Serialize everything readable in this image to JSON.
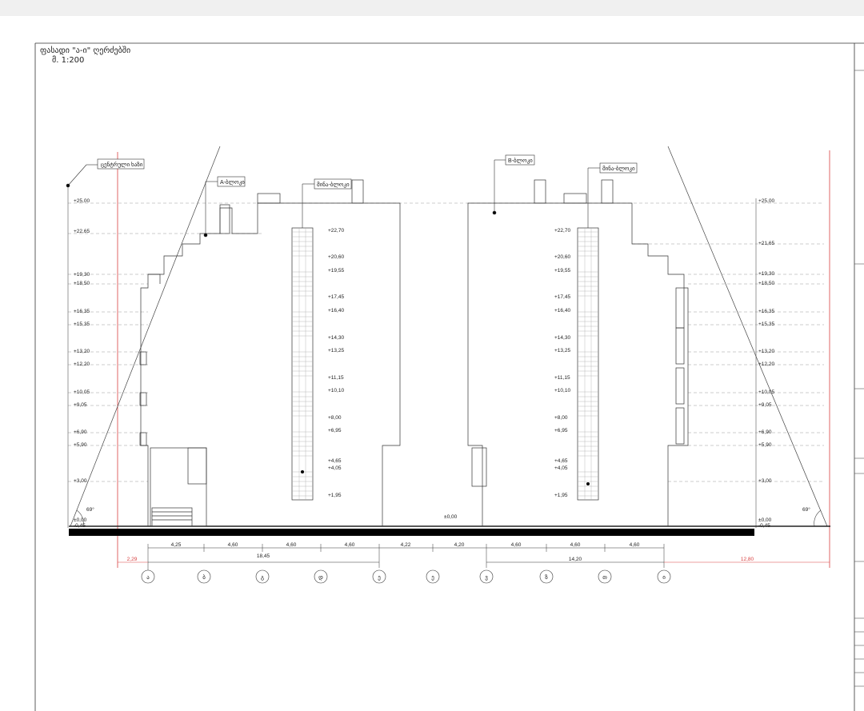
{
  "sheet": {
    "title_line1": "ფასადი \"ა-ი\" ღერძებში",
    "title_line2": "მ. 1:200"
  },
  "labels": {
    "ground_level": "ცენტრული ხაზი",
    "a_section": "A-ბლოკი",
    "b_section": "B-ბლოკი",
    "stair_left": "მინა-ბლოკი",
    "stair_right": "მინა-ბლოკი",
    "center_level": "±0,00",
    "angle_left": "69°",
    "angle_right": "69°"
  },
  "left_levels": [
    "+25,00",
    "+22,65",
    "+19,30",
    "+18,50",
    "+16,35",
    "+15,35",
    "+13,20",
    "+12,20",
    "+10,05",
    "+9,05",
    "+6,90",
    "+5,90",
    "+3,00",
    "±0,00",
    "-0,45"
  ],
  "right_levels": [
    "+25,00",
    "+21,65",
    "+19,30",
    "+18,50",
    "+16,35",
    "+15,35",
    "+13,20",
    "+12,20",
    "+10,05",
    "+9,05",
    "+6,90",
    "+5,90",
    "+3,00",
    "±0,00",
    "-0,45"
  ],
  "stair_levels": [
    "+22,70",
    "+20,60",
    "+19,55",
    "+17,45",
    "+16,40",
    "+14,30",
    "+13,25",
    "+11,15",
    "+10,10",
    "+8,00",
    "+6,95",
    "+4,65",
    "+4,05",
    "+1,95"
  ],
  "dimensions": {
    "segments": [
      "4,25",
      "4,60",
      "4,60",
      "4,60",
      "4,22",
      "4,20",
      "4,60",
      "4,60",
      "4,60"
    ],
    "left_total": "18,45",
    "right_total": "14,20",
    "left_offset": "2,29",
    "right_offset": "12,80"
  },
  "axes": [
    "ა",
    "ბ",
    "გ",
    "დ",
    "ე",
    "ვ",
    "ზ",
    "ჰ",
    "თ",
    "ი"
  ],
  "axis_labels_shown": [
    "ა",
    "ბ",
    "გ",
    "დ",
    "ე",
    "ე",
    "ვ",
    "ზ",
    "თ",
    "ი"
  ],
  "colors": {
    "line": "#333333",
    "red": "#d84040",
    "dash": "#888888"
  }
}
